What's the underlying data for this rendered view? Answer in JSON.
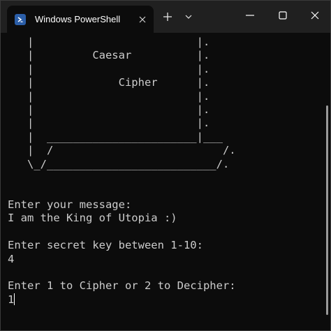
{
  "window": {
    "tab_title": "Windows PowerShell"
  },
  "icons": {
    "tab": "powershell-icon",
    "tab_close": "close-icon",
    "new_tab": "plus-icon",
    "dropdown": "chevron-down-icon",
    "minimize": "minimize-icon",
    "maximize": "maximize-icon",
    "close": "close-icon"
  },
  "console": {
    "lines": [
      "   |                         |.",
      "   |         Caesar          |.",
      "   |                         |.",
      "   |             Cipher      |.",
      "   |                         |.",
      "   |                         |.",
      "   |                         |.",
      "   |  _______________________|___",
      "   |  /                          /.",
      "   \\_/__________________________/.",
      "",
      "",
      "Enter your message:",
      "I am the King of Utopia :)",
      "",
      "Enter secret key between 1-10:",
      "4",
      "",
      "Enter 1 to Cipher or 2 to Decipher:"
    ],
    "input_line": "1"
  },
  "colors": {
    "background": "#0c0c0c",
    "titlebar": "#202020",
    "text": "#cccccc",
    "ps_icon": "#2b5ea8"
  }
}
